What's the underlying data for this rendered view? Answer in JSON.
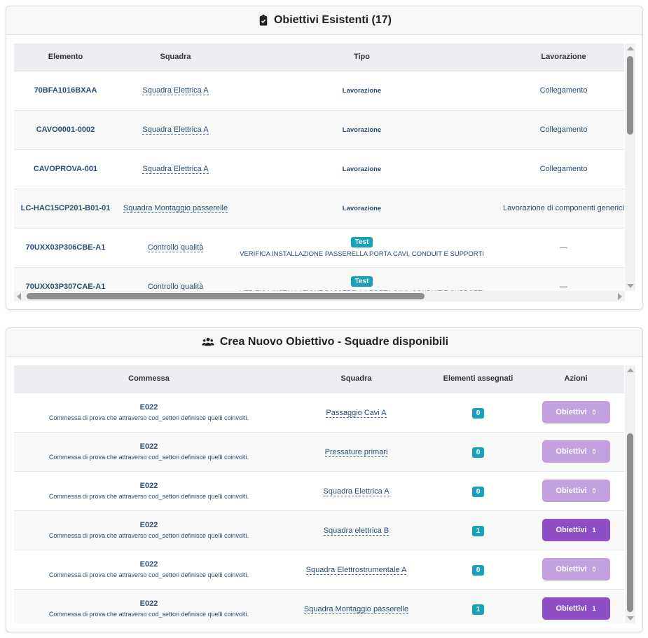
{
  "existing": {
    "title": "Obiettivi Esistenti (17)",
    "icon": "clipboard-check-icon",
    "columns": [
      "Elemento",
      "Squadra",
      "Tipo",
      "Lavorazione"
    ],
    "rows": [
      {
        "elemento": "70BFA1016BXAA",
        "squadra": "Squadra Elettrica A",
        "tipo": "Lavorazione",
        "badge": "",
        "descrizione": "",
        "lavorazione": "Collegamento"
      },
      {
        "elemento": "CAVO0001-0002",
        "squadra": "Squadra Elettrica A",
        "tipo": "Lavorazione",
        "badge": "",
        "descrizione": "",
        "lavorazione": "Collegamento"
      },
      {
        "elemento": "CAVOPROVA-001",
        "squadra": "Squadra Elettrica A",
        "tipo": "Lavorazione",
        "badge": "",
        "descrizione": "",
        "lavorazione": "Collegamento"
      },
      {
        "elemento": "LC-HAC15CP201-B01-01",
        "squadra": "Squadra Montaggio passerelle",
        "tipo": "Lavorazione",
        "badge": "",
        "descrizione": "",
        "lavorazione": "Lavorazione di componenti generici"
      },
      {
        "elemento": "70UXX03P306CBE-A1",
        "squadra": "Controllo qualità",
        "tipo": "",
        "badge": "Test",
        "descrizione": "VERIFICA INSTALLAZIONE PASSERELLA PORTA CAVI, CONDUIT E SUPPORTI",
        "lavorazione": "—"
      },
      {
        "elemento": "70UXX03P307CAE-A1",
        "squadra": "Controllo qualità",
        "tipo": "",
        "badge": "Test",
        "descrizione": "VERIFICA INSTALLAZIONE PASSERELLA PORTA CAVI, CONDUIT E SUPPORTI",
        "lavorazione": "—"
      }
    ]
  },
  "create": {
    "title": "Crea Nuovo Obiettivo - Squadre disponibili",
    "icon": "users-icon",
    "columns": [
      "Commessa",
      "Squadra",
      "Elementi assegnati",
      "Azioni"
    ],
    "button_label": "Obiettivi",
    "rows": [
      {
        "commessa": "E022",
        "descrizione": "Commessa di prova che attraverso cod_settori definisce quelli coinvolti.",
        "squadra": "Passaggio Cavi A",
        "assegnati": "0",
        "obiettivi": "0",
        "enabled": false
      },
      {
        "commessa": "E022",
        "descrizione": "Commessa di prova che attraverso cod_settori definisce quelli coinvolti.",
        "squadra": "Pressature primari",
        "assegnati": "0",
        "obiettivi": "0",
        "enabled": false
      },
      {
        "commessa": "E022",
        "descrizione": "Commessa di prova che attraverso cod_settori definisce quelli coinvolti.",
        "squadra": "Squadra Elettrica A",
        "assegnati": "0",
        "obiettivi": "0",
        "enabled": false
      },
      {
        "commessa": "E022",
        "descrizione": "Commessa di prova che attraverso cod_settori definisce quelli coinvolti.",
        "squadra": "Squadra elettrica B",
        "assegnati": "1",
        "obiettivi": "1",
        "enabled": true
      },
      {
        "commessa": "E022",
        "descrizione": "Commessa di prova che attraverso cod_settori definisce quelli coinvolti.",
        "squadra": "Squadra Elettrostrumentale A",
        "assegnati": "0",
        "obiettivi": "0",
        "enabled": false
      },
      {
        "commessa": "E022",
        "descrizione": "Commessa di prova che attraverso cod_settori definisce quelli coinvolti.",
        "squadra": "Squadra Montaggio passerelle",
        "assegnati": "1",
        "obiettivi": "1",
        "enabled": true
      }
    ]
  },
  "colors": {
    "accent": "#17a2b8",
    "button_active": "#8e4fc6",
    "button_disabled": "#c3a1e0",
    "link": "#2c4d73"
  }
}
